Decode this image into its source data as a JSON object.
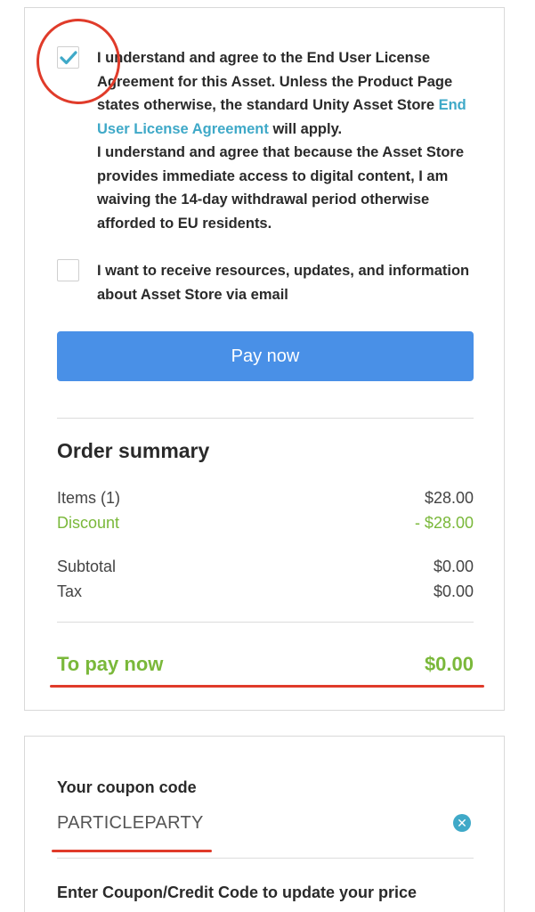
{
  "agreement": {
    "checked": true,
    "text_part1": "I understand and agree to the End User License Agreement for this Asset. Unless the Product Page states otherwise, the standard Unity Asset Store ",
    "link_text": "End User License Agreement",
    "text_part2": " will apply.",
    "text_part3": "I understand and agree that because the Asset Store provides immediate access to digital content, I am waiving the 14-day withdrawal period otherwise afforded to EU residents."
  },
  "newsletter": {
    "checked": false,
    "text": "I want to receive resources, updates, and information about Asset Store via email"
  },
  "pay_button_label": "Pay now",
  "order_summary": {
    "title": "Order summary",
    "items_label": "Items (1)",
    "items_value": "$28.00",
    "discount_label": "Discount",
    "discount_value": "- $28.00",
    "subtotal_label": "Subtotal",
    "subtotal_value": "$0.00",
    "tax_label": "Tax",
    "tax_value": "$0.00",
    "total_label": "To pay now",
    "total_value": "$0.00"
  },
  "coupon": {
    "label": "Your coupon code",
    "value": "PARTICLEPARTY",
    "clear_icon": "clear-icon",
    "info": "Enter Coupon/Credit Code to update your price"
  },
  "colors": {
    "accent_blue": "#4990e7",
    "link": "#3fa9c8",
    "green": "#7ab83a",
    "annotation_red": "#e03b2a"
  }
}
